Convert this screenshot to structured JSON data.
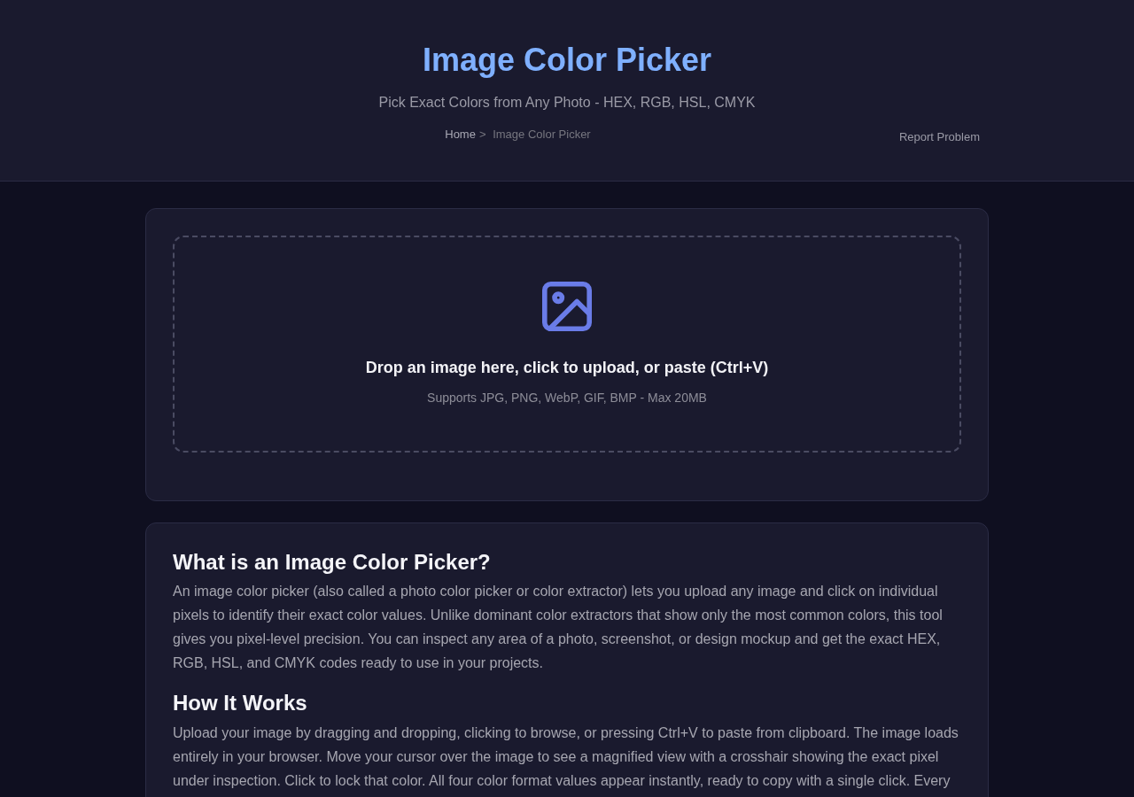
{
  "header": {
    "title": "Image Color Picker",
    "subtitle": "Pick Exact Colors from Any Photo - HEX, RGB, HSL, CMYK",
    "breadcrumb": {
      "separator": ">",
      "items": [
        {
          "label": "Home",
          "kind": "link"
        },
        {
          "label": "Image Color Picker",
          "kind": "current"
        }
      ]
    },
    "report_link": "Report Problem"
  },
  "upload": {
    "prompt": "Drop an image here, click to upload, or paste (Ctrl+V)",
    "hint": "Supports JPG, PNG, WebP, GIF, BMP - Max 20MB"
  },
  "article": {
    "sections": [
      {
        "heading": "What is an Image Color Picker?",
        "text": "An image color picker (also called a photo color picker or color extractor) lets you upload any image and click on individual pixels to identify their exact color values. Unlike dominant color extractors that show only the most common colors, this tool gives you pixel-level precision. You can inspect any area of a photo, screenshot, or design mockup and get the exact HEX, RGB, HSL, and CMYK codes ready to use in your projects."
      },
      {
        "heading": "How It Works",
        "text": "Upload your image by dragging and dropping, clicking to browse, or pressing Ctrl+V to paste from clipboard. The image loads entirely in your browser. Move your cursor over the image to see a magnified view with a crosshair showing the exact pixel under inspection. Click to lock that color. All four color format values appear instantly, ready to copy with a single click. Every"
      }
    ]
  }
}
